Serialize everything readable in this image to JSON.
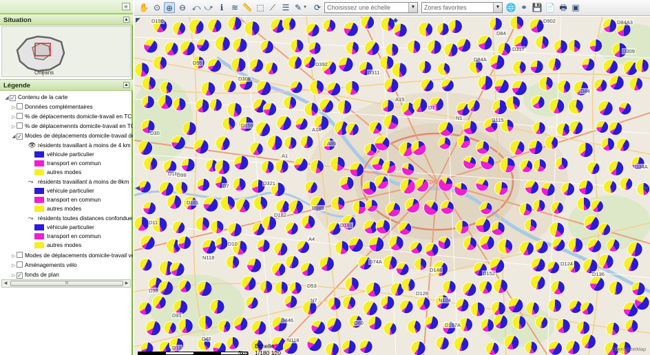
{
  "left_panel": {
    "collapse_glyph": "«",
    "situation": {
      "title": "Situation",
      "overview_city": "Orleans"
    },
    "legend": {
      "title": "Légende",
      "root": "Contenu de la carte",
      "layers": [
        "Données complémentaires",
        "% de déplacements domicile-travail en TC e",
        "% de déplacemennts domicile-travail en TC",
        "Modes de déplacements domicile-travail dep"
      ],
      "groups": [
        {
          "label": "résidents travaillant à moins de 4 km",
          "icon": "eye-icon"
        },
        {
          "label": "résidents travaillant à moins de 8km",
          "icon": "walker-icon"
        },
        {
          "label": "résidents toutes distances confondue",
          "icon": "walker-icon"
        }
      ],
      "modes": [
        {
          "label": "véhicule particulier",
          "color": "#2a1bd6"
        },
        {
          "label": "transport en commun",
          "color": "#f01fd0"
        },
        {
          "label": "autres modes",
          "color": "#f5f01e"
        }
      ],
      "bottom_layers": [
        "Modes de déplacements domicile-travail ver",
        "Aménagements vélo",
        "fonds de plan"
      ],
      "scroll_thumb": "III"
    }
  },
  "toolbar": {
    "scale_placeholder": "Choisissez une échelle",
    "favorites_placeholder": "Zones favorites",
    "icons": [
      "pan-hand-icon",
      "zoom-extent-icon",
      "zoom-in-icon",
      "zoom-out-icon",
      "zoom-previous-icon",
      "zoom-next-icon",
      "info-icon",
      "layers-icon",
      "measure-icon",
      "select-icon",
      "list-icon",
      "draw-icon",
      "refresh-icon",
      "globe-icon",
      "binoculars-icon",
      "save-icon",
      "pdf-icon",
      "print-icon",
      "window-icon"
    ]
  },
  "map": {
    "scale_label": "Échelle :",
    "scale_value": "1/180 120",
    "scale_unit": "9km",
    "road_labels": [
      {
        "t": "D190"
      },
      {
        "t": "D84"
      },
      {
        "t": "D902"
      },
      {
        "t": "D84A3"
      },
      {
        "t": "D55"
      },
      {
        "t": "D317"
      },
      {
        "t": "D309"
      },
      {
        "t": "D308"
      },
      {
        "t": "D392"
      },
      {
        "t": "D311"
      },
      {
        "t": "D84A"
      },
      {
        "t": "D44"
      },
      {
        "t": "A15"
      },
      {
        "t": "D7"
      },
      {
        "t": "N1"
      },
      {
        "t": "D115"
      },
      {
        "t": "D30"
      },
      {
        "t": "D159"
      },
      {
        "t": "A14"
      },
      {
        "t": "A86"
      },
      {
        "t": "A1"
      },
      {
        "t": "D186"
      },
      {
        "t": "D98"
      },
      {
        "t": "D7"
      },
      {
        "t": "D321"
      },
      {
        "t": "D34A"
      },
      {
        "t": "D161"
      },
      {
        "t": "D985"
      },
      {
        "t": "D182"
      },
      {
        "t": "D181"
      },
      {
        "t": "A4"
      },
      {
        "t": "D11"
      },
      {
        "t": "D10"
      },
      {
        "t": "N118"
      },
      {
        "t": "D74A"
      },
      {
        "t": "D148"
      },
      {
        "t": "D152"
      },
      {
        "t": "D124"
      },
      {
        "t": "D136"
      },
      {
        "t": "D35"
      },
      {
        "t": "D53"
      },
      {
        "t": "D126"
      },
      {
        "t": "N7"
      },
      {
        "t": "N104"
      },
      {
        "t": "D91"
      },
      {
        "t": "D446"
      },
      {
        "t": "D60"
      },
      {
        "t": "D167A"
      },
      {
        "t": "D13"
      },
      {
        "t": "D46"
      },
      {
        "t": "N118"
      }
    ],
    "credits": "OpenStreetMap"
  }
}
